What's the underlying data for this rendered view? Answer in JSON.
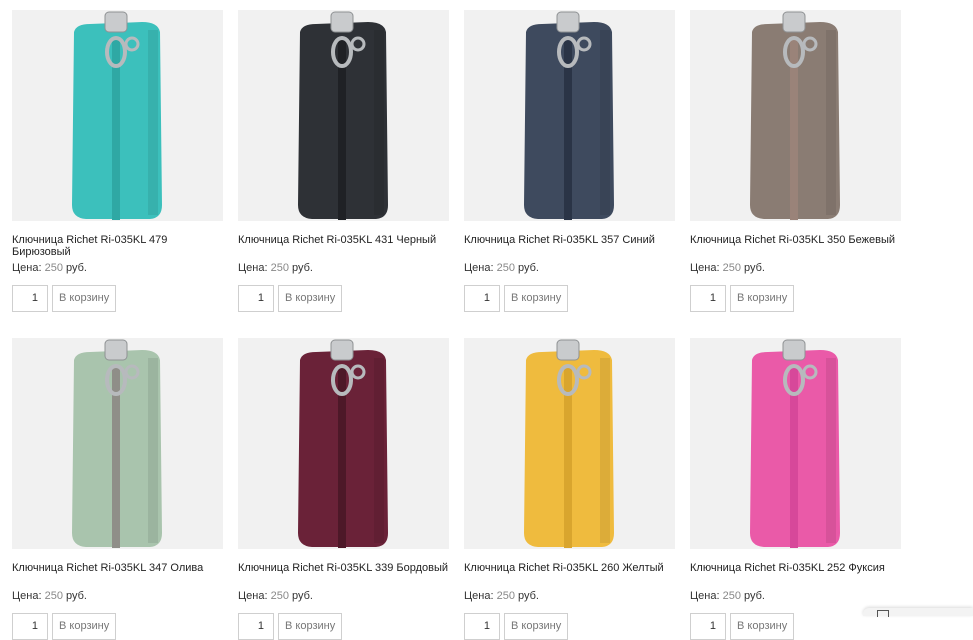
{
  "products": [
    {
      "title": "Ключница Richet Ri-035KL 479 Бирюзовый",
      "price_label": "Цена:",
      "price": "250",
      "currency": "руб.",
      "qty": "1",
      "cart_label": "В корзину",
      "color": "#3cc0bc",
      "zip": "#2fa8a4"
    },
    {
      "title": "Ключница Richet Ri-035KL 431 Черный",
      "price_label": "Цена:",
      "price": "250",
      "currency": "руб.",
      "qty": "1",
      "cart_label": "В корзину",
      "color": "#2e3136",
      "zip": "#1f2125"
    },
    {
      "title": "Ключница Richet Ri-035KL 357 Синий",
      "price_label": "Цена:",
      "price": "250",
      "currency": "руб.",
      "qty": "1",
      "cart_label": "В корзину",
      "color": "#3e4a5e",
      "zip": "#2a3446"
    },
    {
      "title": "Ключница Richet Ri-035KL 350 Бежевый",
      "price_label": "Цена:",
      "price": "250",
      "currency": "руб.",
      "qty": "1",
      "cart_label": "В корзину",
      "color": "#8a7c73",
      "zip": "#9a8379"
    },
    {
      "title": "Ключница Richet Ri-035KL 347 Олива",
      "price_label": "Цена:",
      "price": "250",
      "currency": "руб.",
      "qty": "1",
      "cart_label": "В корзину",
      "color": "#a9c4ad",
      "zip": "#8f8e88"
    },
    {
      "title": "Ключница Richet Ri-035KL 339 Бордовый",
      "price_label": "Цена:",
      "price": "250",
      "currency": "руб.",
      "qty": "1",
      "cart_label": "В корзину",
      "color": "#6a2238",
      "zip": "#4d1828"
    },
    {
      "title": "Ключница Richet Ri-035KL 260 Желтый",
      "price_label": "Цена:",
      "price": "250",
      "currency": "руб.",
      "qty": "1",
      "cart_label": "В корзину",
      "color": "#efbb3e",
      "zip": "#d9a52e"
    },
    {
      "title": "Ключница Richet Ri-035KL 252 Фуксия",
      "price_label": "Цена:",
      "price": "250",
      "currency": "руб.",
      "qty": "1",
      "cart_label": "В корзину",
      "color": "#ea5aa8",
      "zip": "#d7489a"
    }
  ],
  "corner_widget": {
    "icon": "chat-icon"
  }
}
